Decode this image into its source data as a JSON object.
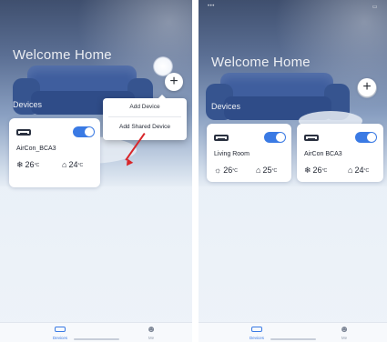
{
  "left": {
    "title": "Welcome Home",
    "devices_label": "Devices",
    "add_button": "+",
    "menu": {
      "items": [
        "Add Device",
        "Add Shared Device"
      ]
    },
    "card": {
      "name": "AirCon_BCA3",
      "readings": [
        {
          "icon": "❄",
          "value": "26",
          "unit": "°C"
        },
        {
          "icon": "⌂",
          "value": "24",
          "unit": "°C"
        }
      ]
    },
    "tabs": [
      {
        "icon": "home-icon",
        "label": "Devices"
      },
      {
        "icon": "user-icon",
        "label": "Me"
      }
    ]
  },
  "right": {
    "title": "Welcome Home",
    "devices_label": "Devices",
    "add_button": "+",
    "cards": [
      {
        "name": "Living Room",
        "readings": [
          {
            "icon": "☼",
            "value": "26",
            "unit": "°C"
          },
          {
            "icon": "⌂",
            "value": "25",
            "unit": "°C"
          }
        ]
      },
      {
        "name": "AirCon BCA3",
        "readings": [
          {
            "icon": "❄",
            "value": "26",
            "unit": "°C"
          },
          {
            "icon": "⌂",
            "value": "24",
            "unit": "°C"
          }
        ]
      }
    ],
    "tabs": [
      {
        "icon": "home-icon",
        "label": "Devices"
      },
      {
        "icon": "user-icon",
        "label": "Me"
      }
    ]
  },
  "colors": {
    "accent": "#3a7ae4",
    "arrow": "#d8262a"
  }
}
